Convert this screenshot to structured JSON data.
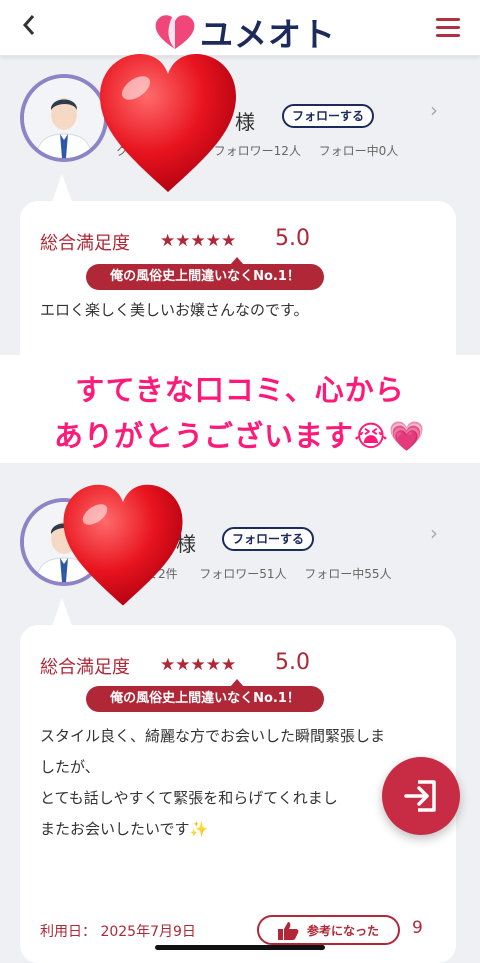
{
  "header": {
    "back_icon": "chevron-left-icon",
    "logo_text": "ユメオト",
    "menu_icon": "hamburger-icon",
    "menu_color": "#b03040",
    "brand_color": "#1c2a5c"
  },
  "reviews": [
    {
      "username_suffix": "様",
      "follow_label": "フォローする",
      "stats_prefix": "ク",
      "followers": "フォロワー12人",
      "following": "フォロー中0人",
      "satisfaction_label": "総合満足度",
      "stars": "★★★★★",
      "score": "5.0",
      "title": "俺の風俗史上間違いなくNo.1！",
      "body": [
        "エロく楽しく美しいお嬢さんなのです。"
      ]
    },
    {
      "username_suffix": "様",
      "follow_label": "フォローする",
      "stats_prefix": "ミ2件",
      "followers": "フォロワー51人",
      "following": "フォロー中55人",
      "satisfaction_label": "総合満足度",
      "stars": "★★★★★",
      "score": "5.0",
      "title": "俺の風俗史上間違いなくNo.1！",
      "body": [
        "スタイル良く、綺麗な方でお会いした瞬間緊張しま",
        "したが、",
        "とても話しやすくて緊張を和らげてくれまし",
        "またお会いしたいです✨"
      ],
      "date": "利用日： 2025年7月9日",
      "helpful_label": "参考になった",
      "helpful_count": "9"
    }
  ],
  "banner": {
    "line1": "すてきな口コミ、心から",
    "line2": "ありがとうございます😭💗",
    "color": "#ff1a7a"
  },
  "accent_color": "#b02838",
  "fab_icon": "login-arrow-icon"
}
